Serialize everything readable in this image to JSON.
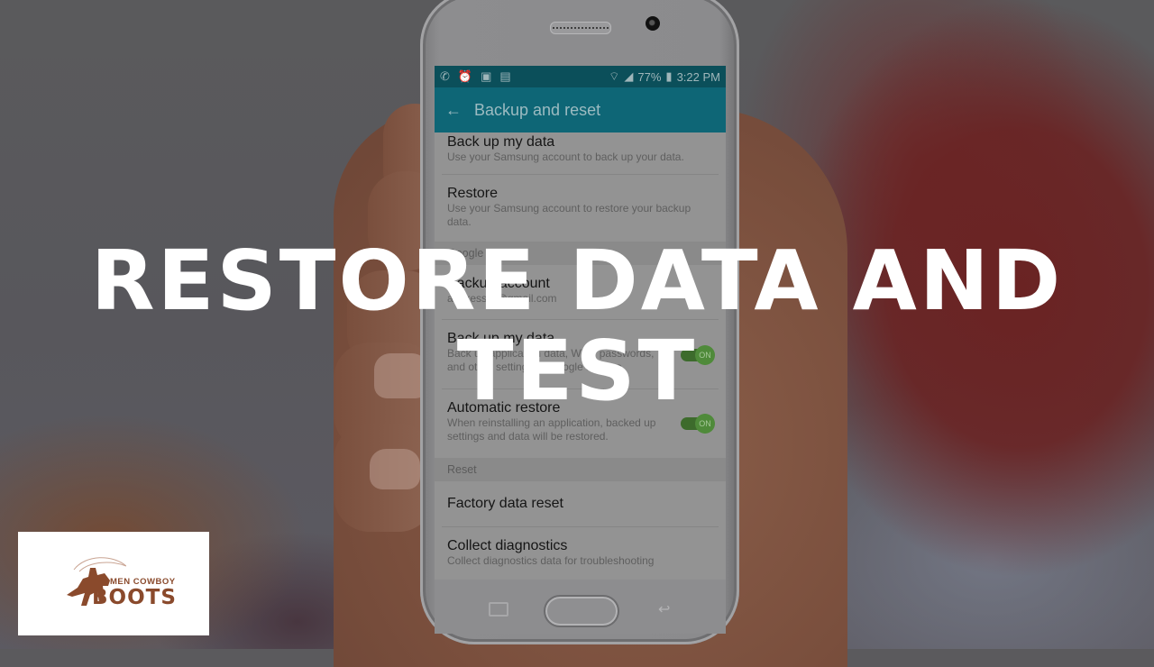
{
  "headline": {
    "line1": "RESTORE DATA AND",
    "line2": "TEST"
  },
  "phone": {
    "status_bar": {
      "left_icons": [
        "call-forwarding-icon",
        "alarm-icon",
        "gallery-icon",
        "sim-icon"
      ],
      "battery": "77%",
      "time": "3:22 PM"
    },
    "app_bar": {
      "title": "Backup and reset",
      "back_icon": "arrow-left-icon"
    },
    "items": [
      {
        "title": "Back up my data",
        "sub": "Use your Samsung account to back up your data."
      },
      {
        "title": "Restore",
        "sub": "Use your Samsung account to restore your backup data."
      }
    ],
    "google_section": {
      "header": "Google account",
      "backup_account": {
        "title": "Backup account",
        "sub": "a.lttkesser@gmail.com"
      },
      "back_up_data": {
        "title": "Back up my data",
        "sub": "Back up application data, Wi-Fi passwords, and other settings to Google servers.",
        "toggle": "ON"
      },
      "automatic_restore": {
        "title": "Automatic restore",
        "sub": "When reinstalling an application, backed up settings and data will be restored.",
        "toggle": "ON"
      }
    },
    "reset_section": {
      "header": "Reset",
      "factory_reset": {
        "title": "Factory data reset"
      },
      "collect_diagnostics": {
        "title": "Collect diagnostics",
        "sub": "Collect diagnostics data for troubleshooting"
      }
    }
  },
  "logo": {
    "small": "MEN COWBOY",
    "big": "BOOTS",
    "color": "#8a4a2c"
  }
}
